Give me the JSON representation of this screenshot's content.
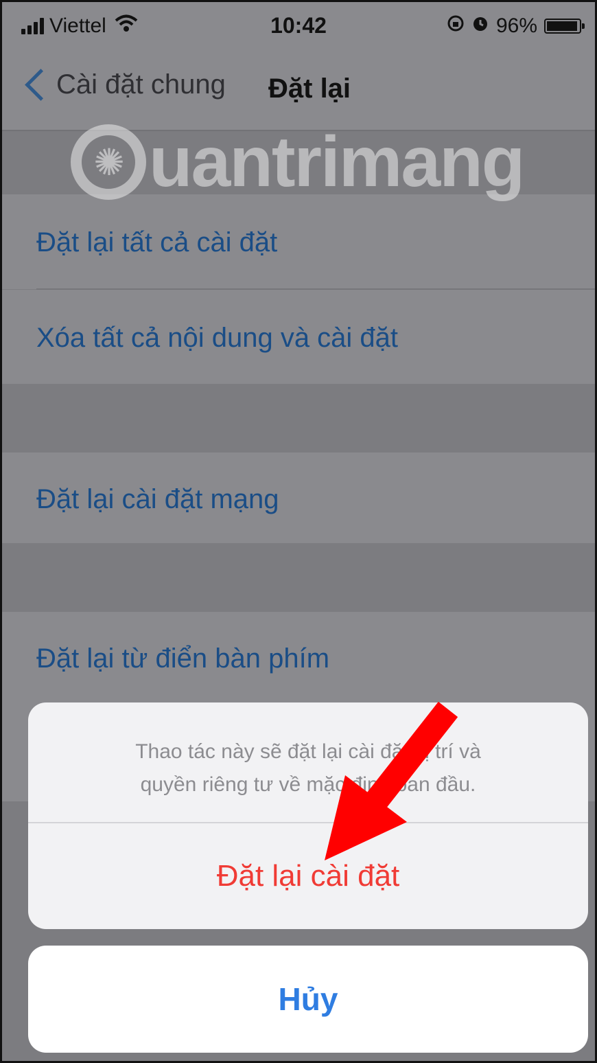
{
  "status_bar": {
    "carrier": "Viettel",
    "time": "10:42",
    "battery": "96%",
    "battery_level": 0.96
  },
  "nav": {
    "back_label": "Cài đặt chung",
    "title": "Đặt lại"
  },
  "watermark": "uantrimang",
  "cells": {
    "reset_all": "Đặt lại tất cả cài đặt",
    "erase_all": "Xóa tất cả nội dung và cài đặt",
    "reset_network": "Đặt lại cài đặt mạng",
    "reset_keyboard": "Đặt lại từ điển bàn phím"
  },
  "action_sheet": {
    "message_line1": "Thao tác này sẽ đặt lại cài đặt vị trí và",
    "message_line2": "quyền riêng tư về mặc định ban đầu.",
    "destructive_label": "Đặt lại cài đặt",
    "cancel_label": "Hủy"
  },
  "colors": {
    "link_blue": "#1a4d86",
    "destructive_red": "#f03b35",
    "cancel_blue": "#2f7de1",
    "arrow_red": "#ff0000"
  }
}
